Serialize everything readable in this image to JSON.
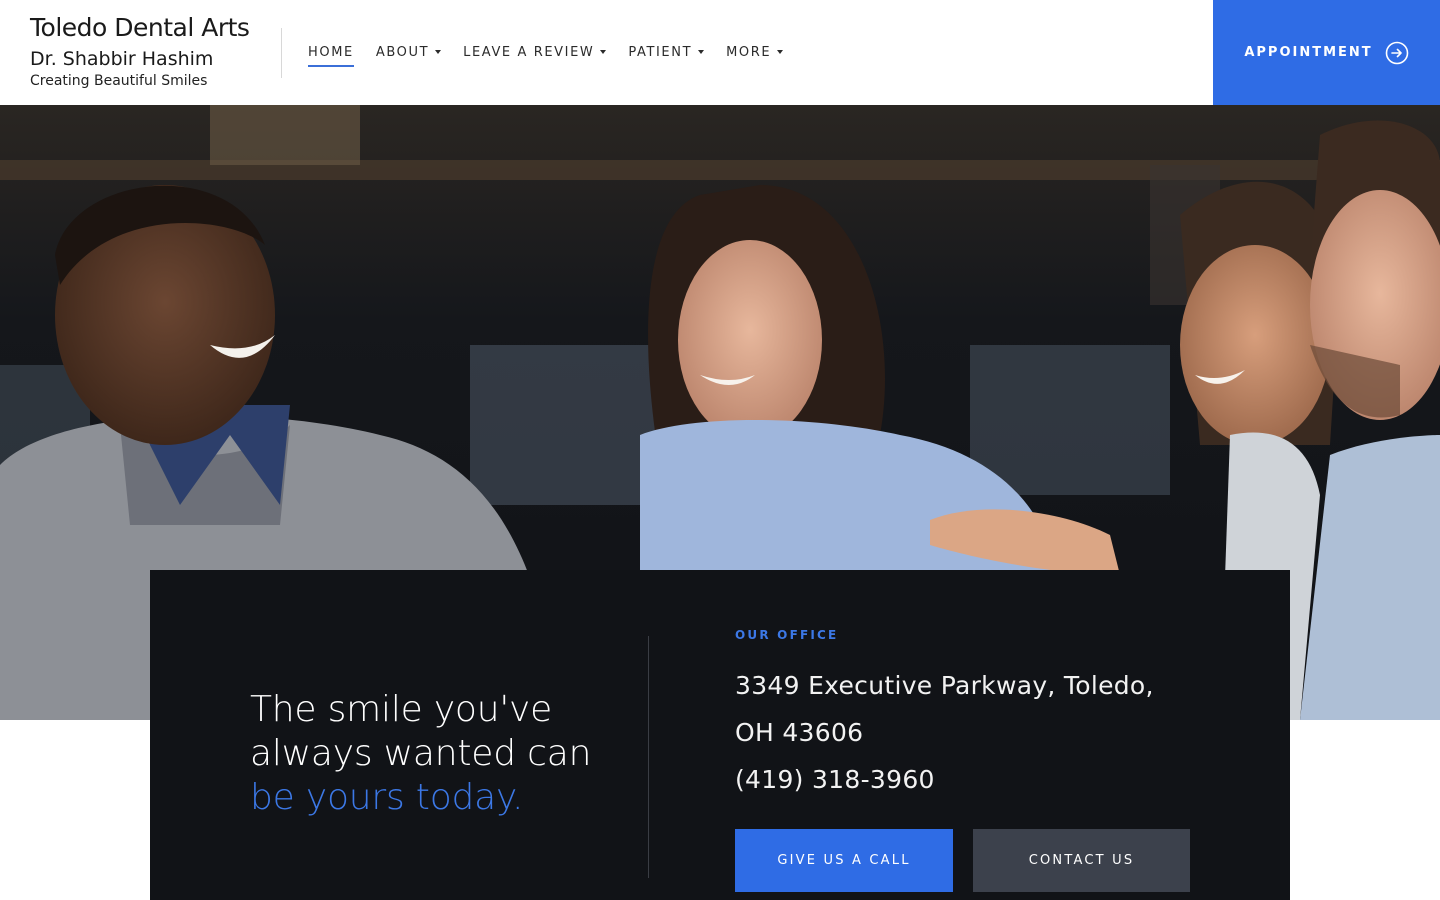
{
  "header": {
    "brand_name": "Toledo Dental Arts",
    "doctor": "Dr. Shabbir Hashim",
    "tagline": "Creating Beautiful Smiles",
    "nav": [
      {
        "label": "HOME",
        "active": true,
        "dropdown": false
      },
      {
        "label": "ABOUT",
        "active": false,
        "dropdown": true
      },
      {
        "label": "LEAVE A REVIEW",
        "active": false,
        "dropdown": true
      },
      {
        "label": "PATIENT",
        "active": false,
        "dropdown": true
      },
      {
        "label": "MORE",
        "active": false,
        "dropdown": true
      }
    ],
    "appointment_label": "APPOINTMENT",
    "appointment_icon": "arrow-circle-right-icon"
  },
  "hero": {
    "image": "photo of four smiling friends talking at a cafe table"
  },
  "panel": {
    "headline_line1": "The smile you've",
    "headline_line2": "always wanted can",
    "headline_accent": "be yours today.",
    "office_label": "OUR OFFICE",
    "address_line1": "3349 Executive Parkway, Toledo,",
    "address_line2": "OH 43606",
    "phone": "(419) 318-3960",
    "call_button": "GIVE US A CALL",
    "contact_button": "CONTACT US"
  },
  "colors": {
    "accent": "#2f6ce5",
    "panel_bg": "#111317",
    "contact_btn": "#3c414c"
  }
}
